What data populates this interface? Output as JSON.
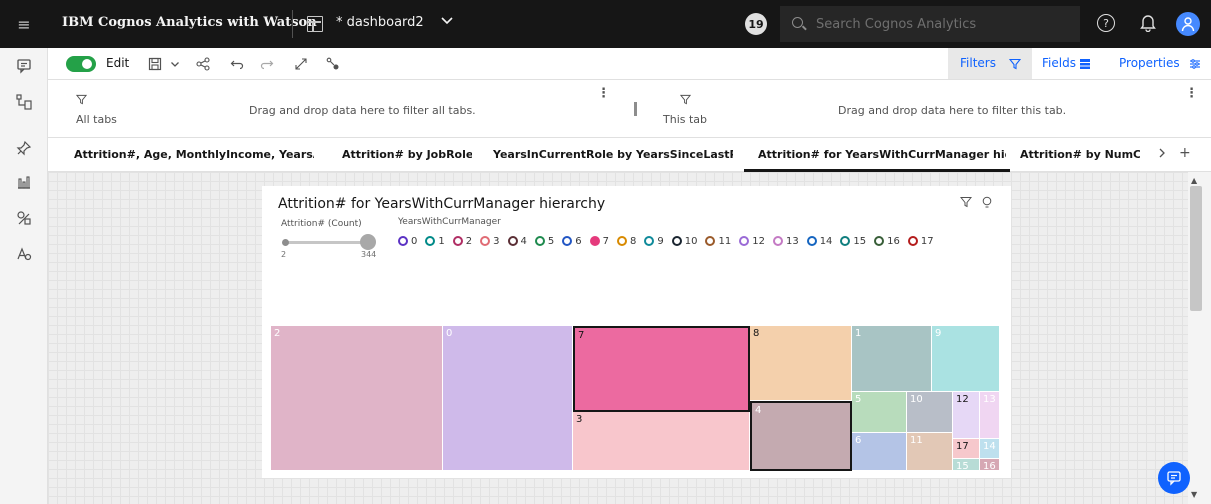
{
  "app": {
    "title": "IBM Cognos Analytics with Watson",
    "dashboard_name": "* dashboard2",
    "notifications": "19",
    "search_placeholder": "Search Cognos Analytics"
  },
  "toolbar": {
    "edit_label": "Edit",
    "filters_label": "Filters",
    "fields_label": "Fields",
    "properties_label": "Properties"
  },
  "filters": {
    "all_tabs_label": "All tabs",
    "all_tabs_drop": "Drag and drop data here to filter all tabs.",
    "this_tab_label": "This tab",
    "this_tab_drop": "Drag and drop data here to filter this tab."
  },
  "tabs": [
    "Attrition#, Age, MonthlyIncome, YearsAtC(",
    "Attrition# by JobRole",
    "YearsInCurrentRole by YearsSinceLastPr(",
    "Attrition# for YearsWithCurrManager hier",
    "Attrition# by NumCo"
  ],
  "widget": {
    "title": "Attrition# for YearsWithCurrManager hierarchy",
    "size_legend_title": "Attrition# (Count)",
    "size_min": "2",
    "size_max": "344",
    "color_legend_title": "YearsWithCurrManager"
  },
  "chart_data": {
    "type": "treemap",
    "title": "Attrition# for YearsWithCurrManager hierarchy",
    "size_measure": "Attrition# (Count)",
    "size_range": [
      2,
      344
    ],
    "color_category": "YearsWithCurrManager",
    "categories": [
      "0",
      "1",
      "2",
      "3",
      "4",
      "5",
      "6",
      "7",
      "8",
      "9",
      "10",
      "11",
      "12",
      "13",
      "14",
      "15",
      "16",
      "17"
    ],
    "colors": [
      "#b99cf0",
      "#4bb7b3",
      "#d57ca2",
      "#f59ca1",
      "#8f6a6f",
      "#6ab98a",
      "#5a82d0",
      "#e53a7c",
      "#eaa44c",
      "#4cb6c4",
      "#4e5e70",
      "#bf9575",
      "#c8a6ee",
      "#e2a9e2",
      "#4e8fd0",
      "#3aa0a0",
      "#6e8a6e",
      "#d84c4c"
    ],
    "legend_border": [
      "#5b32c4",
      "#008a88",
      "#b02e64",
      "#e06b74",
      "#5a2e35",
      "#1e8a4e",
      "#2256c4",
      "#e53a7c",
      "#d88a00",
      "#0f8a9a",
      "#1a2530",
      "#9a5a2a",
      "#9a6ad6",
      "#c47ac4",
      "#1565c0",
      "#0f7e7e",
      "#385e38",
      "#b41c1c"
    ],
    "cells": [
      {
        "id": "2",
        "value": 344,
        "fill": "#e0b4c8",
        "text_dark": false
      },
      {
        "id": "0",
        "value": 263,
        "fill": "#cfbaea",
        "text_dark": false
      },
      {
        "id": "7",
        "value": 216,
        "fill": "#ec6aa0",
        "text_dark": true,
        "outlined": true
      },
      {
        "id": "3",
        "value": 142,
        "fill": "#f8c6cc",
        "text_dark": true
      },
      {
        "id": "8",
        "value": 107,
        "fill": "#f4d0ac",
        "text_dark": true
      },
      {
        "id": "4",
        "value": 98,
        "fill": "#c4aab0",
        "text_dark": false,
        "outlined": true
      },
      {
        "id": "1",
        "value": 76,
        "fill": "#a8c4c4",
        "text_dark": false
      },
      {
        "id": "9",
        "value": 64,
        "fill": "#aae2e2",
        "text_dark": false
      },
      {
        "id": "5",
        "value": 31,
        "fill": "#b8dcbc",
        "text_dark": false
      },
      {
        "id": "10",
        "value": 27,
        "fill": "#b8bec8",
        "text_dark": false
      },
      {
        "id": "12",
        "value": 18,
        "fill": "#e6d8f6",
        "text_dark": true
      },
      {
        "id": "13",
        "value": 14,
        "fill": "#f0d6f2",
        "text_dark": false
      },
      {
        "id": "6",
        "value": 29,
        "fill": "#b4c4e6",
        "text_dark": false
      },
      {
        "id": "11",
        "value": 22,
        "fill": "#e2c8b6",
        "text_dark": false
      },
      {
        "id": "17",
        "value": 7,
        "fill": "#f6c8cc",
        "text_dark": true
      },
      {
        "id": "14",
        "value": 5,
        "fill": "#bee0ee",
        "text_dark": false
      },
      {
        "id": "15",
        "value": 2,
        "fill": "#b8dcd6",
        "text_dark": false
      },
      {
        "id": "16",
        "value": 2,
        "fill": "#d6a8b4",
        "text_dark": false
      }
    ]
  }
}
